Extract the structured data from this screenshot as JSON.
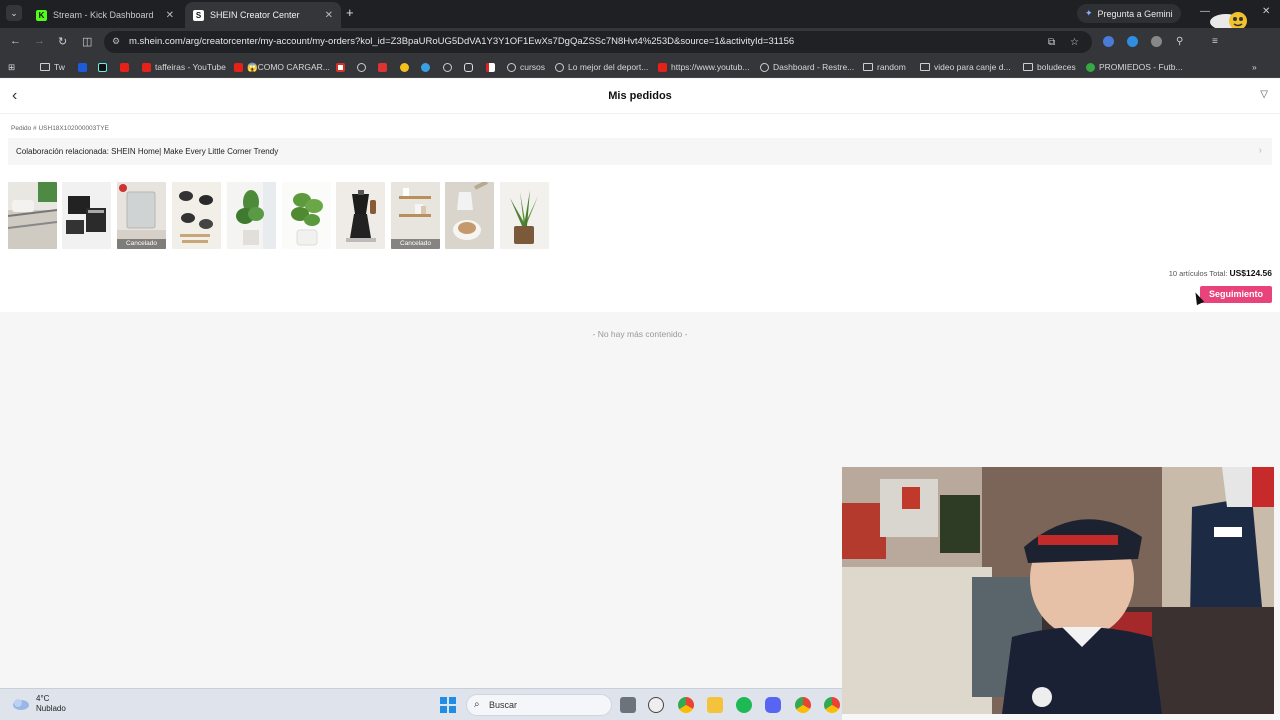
{
  "browser": {
    "tabs": [
      {
        "title": "Stream - Kick Dashboard",
        "favicon": "kick-icon",
        "color": "#53fc18",
        "active": false
      },
      {
        "title": "SHEIN Creator Center",
        "favicon": "shein-icon",
        "color": "#ffffff",
        "active": true
      }
    ],
    "gemini_label": "Pregunta a Gemini",
    "url": "m.shein.com/arg/creatorcenter/my-account/my-orders?kol_id=Z3BpaURoUG5DdVA1Y3Y1OF1EwXs7DgQaZSSc7N8Hvt4%253D&source=1&activityId=31156"
  },
  "bookmarks": [
    {
      "label": "Tw",
      "icon": "folder-icon"
    },
    {
      "label": "",
      "icon": "paramount-icon"
    },
    {
      "label": "",
      "icon": "tiktok-icon"
    },
    {
      "label": "",
      "icon": "youtube-icon"
    },
    {
      "label": "taffeiras - YouTube",
      "icon": "youtube-icon"
    },
    {
      "label": "😱COMO CARGAR...",
      "icon": "youtube-icon"
    },
    {
      "label": "",
      "icon": "gmail-icon"
    },
    {
      "label": "",
      "icon": "globe-icon"
    },
    {
      "label": "",
      "icon": "red-icon"
    },
    {
      "label": "",
      "icon": "yellow-icon"
    },
    {
      "label": "",
      "icon": "blue-icon"
    },
    {
      "label": "",
      "icon": "globe-icon"
    },
    {
      "label": "",
      "icon": "instagram-icon"
    },
    {
      "label": "",
      "icon": "river-icon"
    },
    {
      "label": "cursos",
      "icon": "globe-icon"
    },
    {
      "label": "Lo mejor del deport...",
      "icon": "globe-icon"
    },
    {
      "label": "https://www.youtub...",
      "icon": "youtube-icon"
    },
    {
      "label": "Dashboard - Restre...",
      "icon": "globe-icon"
    },
    {
      "label": "random",
      "icon": "folder-icon"
    },
    {
      "label": "video para canje d...",
      "icon": "folder-icon"
    },
    {
      "label": "boludeces",
      "icon": "folder-icon"
    },
    {
      "label": "PROMIEDOS - Futb...",
      "icon": "promiedos-icon"
    }
  ],
  "page": {
    "title": "Mis pedidos",
    "order_id": "Pedido # USH18X102000003TYE",
    "collab": "Colaboración relacionada: SHEIN Home| Make Every Little Corner Trendy",
    "thumbnails": [
      {
        "name": "bed-linen-product",
        "cancelled": false,
        "status": ""
      },
      {
        "name": "storage-box-product",
        "cancelled": false,
        "status": ""
      },
      {
        "name": "mirror-product",
        "cancelled": true,
        "status": "Cancelado"
      },
      {
        "name": "kitchen-utensils-product",
        "cancelled": false,
        "status": ""
      },
      {
        "name": "plant-product",
        "cancelled": false,
        "status": ""
      },
      {
        "name": "fiddle-leaf-plant-product",
        "cancelled": false,
        "status": ""
      },
      {
        "name": "moka-pot-product",
        "cancelled": false,
        "status": ""
      },
      {
        "name": "wall-shelf-product",
        "cancelled": true,
        "status": "Cancelado"
      },
      {
        "name": "milk-frother-product",
        "cancelled": false,
        "status": ""
      },
      {
        "name": "snake-plant-product",
        "cancelled": false,
        "status": ""
      }
    ],
    "items_count": "10 artículos Total:",
    "total": "US$124.56",
    "track_button": "Seguimiento",
    "no_more": "- No hay más contenido -"
  },
  "taskbar": {
    "temperature": "4°C",
    "weather": "Nublado",
    "search": "Buscar"
  },
  "colors": {
    "accent": "#e8437a",
    "chrome_dark": "#1f2023",
    "chrome_toolbar": "#35363a"
  }
}
